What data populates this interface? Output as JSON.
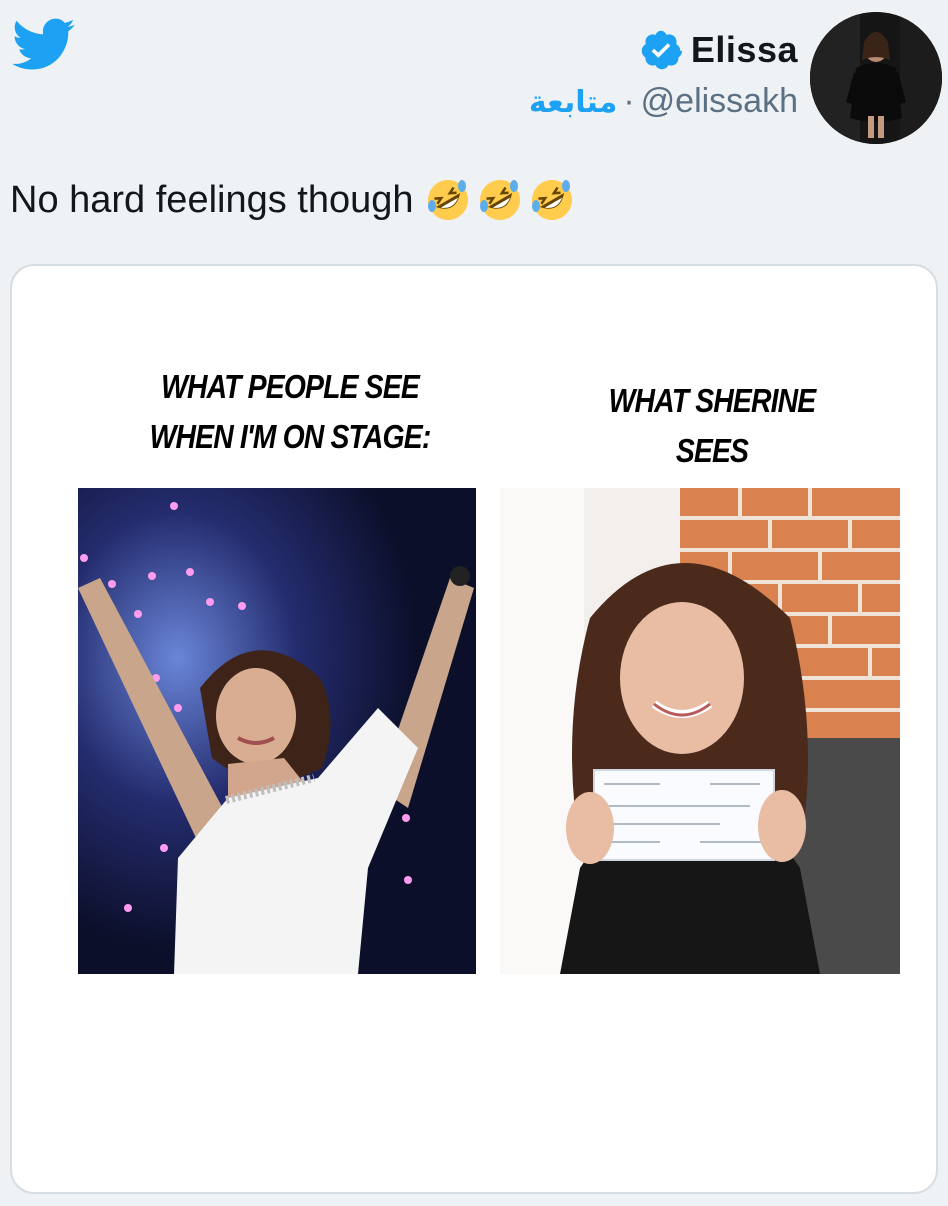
{
  "header": {
    "display_name": "Elissa",
    "handle": "@elissakh",
    "separator": "·",
    "follow_label": "متابعة"
  },
  "tweet": {
    "text": "No hard feelings though"
  },
  "emojis": [
    "rolling-on-floor-laughing-emoji",
    "rolling-on-floor-laughing-emoji",
    "rolling-on-floor-laughing-emoji"
  ],
  "media": {
    "left_caption": "WHAT PEOPLE SEE WHEN I'M ON STAGE:",
    "right_caption": "WHAT SHERINE SEES"
  },
  "colors": {
    "twitter_blue": "#1da1f2",
    "background": "#eef2f5"
  }
}
